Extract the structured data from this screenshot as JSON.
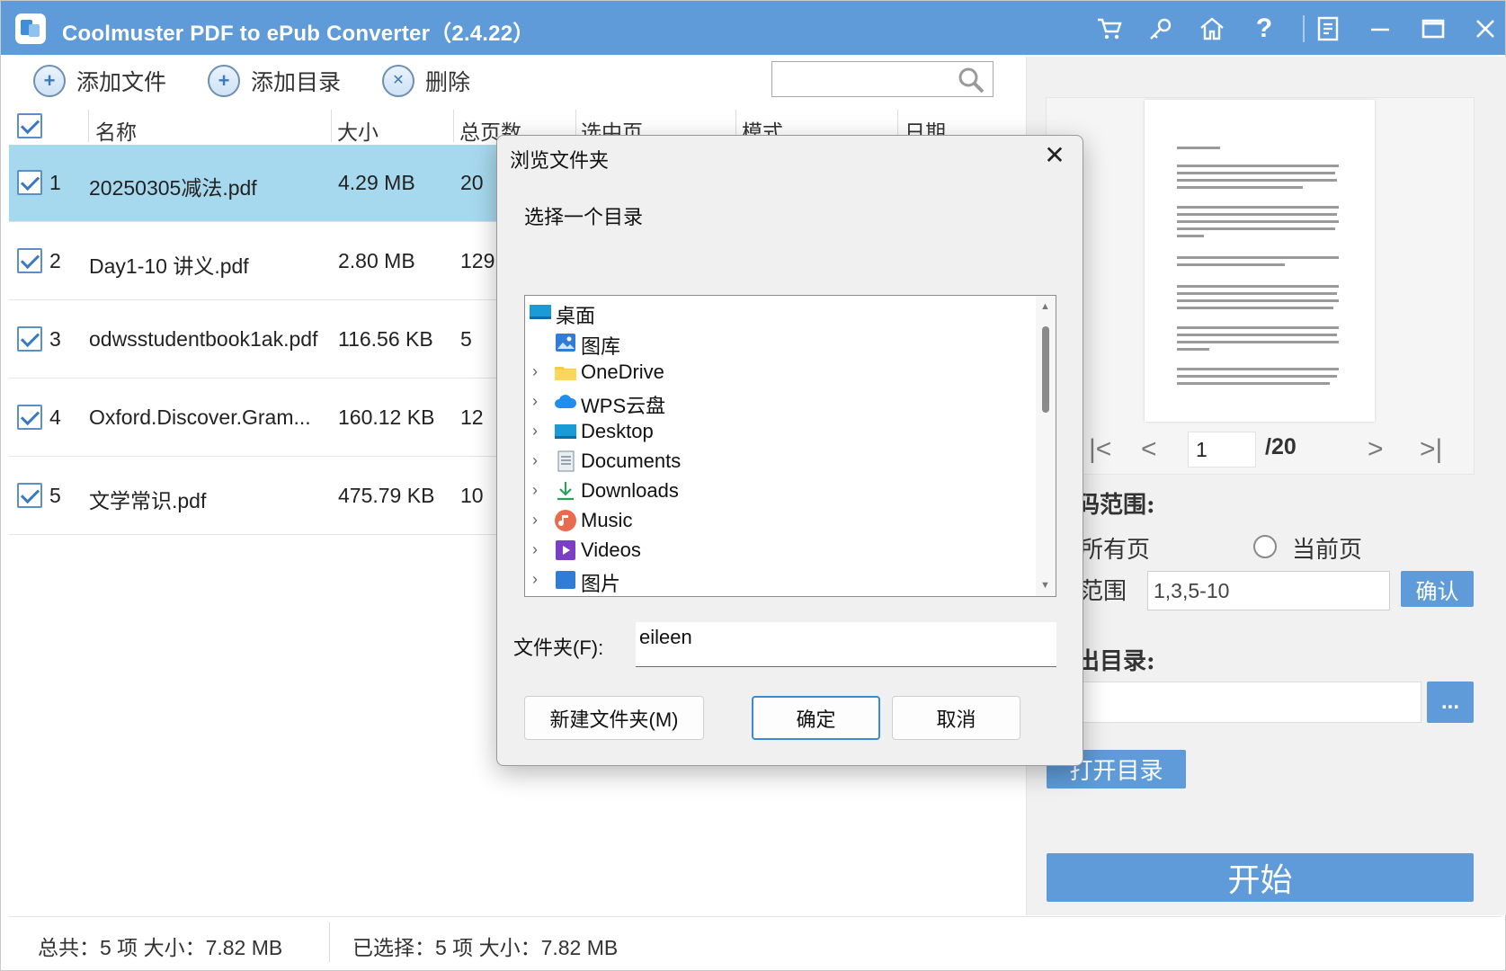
{
  "app": {
    "title": "Coolmuster PDF to ePub Converter（2.4.22）",
    "colors": {
      "titlebar": "#5e9bd8",
      "selected_row": "#a7d9ee",
      "accent_button": "#5e9bd8"
    },
    "titlebar_icons": [
      "cart-icon",
      "key-icon",
      "home-icon",
      "help-icon",
      "register-icon",
      "minimize-icon",
      "maximize-icon",
      "close-icon"
    ]
  },
  "toolbar": {
    "add_file": "添加文件",
    "add_folder": "添加目录",
    "delete": "删除",
    "search_placeholder": ""
  },
  "table": {
    "headers": {
      "name": "名称",
      "size": "大小",
      "pages": "总页数",
      "selected_pages": "选中页",
      "mode": "模式",
      "date": "日期"
    },
    "rows": [
      {
        "index": "1",
        "name": "20250305减法.pdf",
        "size": "4.29 MB",
        "pages": "20",
        "checked": true,
        "selected": true
      },
      {
        "index": "2",
        "name": "Day1-10 讲义.pdf",
        "size": "2.80 MB",
        "pages": "129",
        "checked": true,
        "selected": false
      },
      {
        "index": "3",
        "name": "odwsstudentbook1ak.pdf",
        "size": "116.56 KB",
        "pages": "5",
        "checked": true,
        "selected": false
      },
      {
        "index": "4",
        "name": "Oxford.Discover.Gram...",
        "size": "160.12 KB",
        "pages": "12",
        "checked": true,
        "selected": false
      },
      {
        "index": "5",
        "name": "文学常识.pdf",
        "size": "475.79 KB",
        "pages": "10",
        "checked": true,
        "selected": false
      }
    ]
  },
  "status": {
    "total": "总共：5 项 大小：7.82 MB",
    "selected": "已选择：5 项 大小：7.82 MB"
  },
  "preview": {
    "current_page": "1",
    "total_pages": "/20"
  },
  "options": {
    "page_range_label": "码范围:",
    "all_pages": "所有页",
    "current_page": "当前页",
    "range_label": "范围",
    "range_value": "1,3,5-10",
    "confirm": "确认",
    "output_label": "出目录:",
    "browse": "...",
    "open_folder": "打开目录",
    "start": "开始"
  },
  "dialog": {
    "title": "浏览文件夹",
    "close": "✕",
    "prompt": "选择一个目录",
    "tree": [
      {
        "label": "桌面",
        "icon": "desktop-icon",
        "expandable": false,
        "level": 0
      },
      {
        "label": "图库",
        "icon": "gallery-icon",
        "expandable": false,
        "level": 1
      },
      {
        "label": "OneDrive",
        "icon": "folder-icon",
        "expandable": true,
        "level": 1
      },
      {
        "label": "WPS云盘",
        "icon": "cloud-icon",
        "expandable": true,
        "level": 1
      },
      {
        "label": "Desktop",
        "icon": "desktop-folder-icon",
        "expandable": true,
        "level": 1
      },
      {
        "label": "Documents",
        "icon": "documents-icon",
        "expandable": true,
        "level": 1
      },
      {
        "label": "Downloads",
        "icon": "downloads-icon",
        "expandable": true,
        "level": 1
      },
      {
        "label": "Music",
        "icon": "music-icon",
        "expandable": true,
        "level": 1
      },
      {
        "label": "Videos",
        "icon": "videos-icon",
        "expandable": true,
        "level": 1
      },
      {
        "label": "图片",
        "icon": "pictures-icon",
        "expandable": true,
        "level": 1
      }
    ],
    "folder_label": "文件夹(F):",
    "folder_value": "eileen",
    "new_folder": "新建文件夹(M)",
    "ok": "确定",
    "cancel": "取消"
  }
}
